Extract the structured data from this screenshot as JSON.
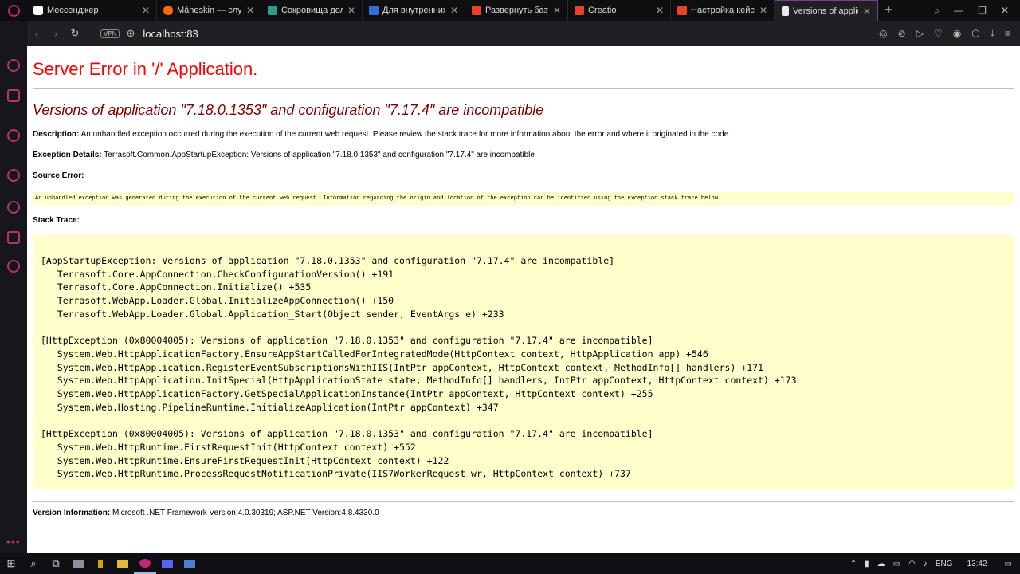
{
  "tabs": [
    {
      "label": "Мессенджер",
      "favicon_color": "#ffffff"
    },
    {
      "label": "Måneskin — слуша",
      "favicon_color": "#ff6a00"
    },
    {
      "label": "Сокровища долин",
      "favicon_color": "#2a9d8f"
    },
    {
      "label": "Для внутренних за",
      "favicon_color": "#2f6fd6"
    },
    {
      "label": "Развернуть базу д",
      "favicon_color": "#e8412c"
    },
    {
      "label": "Creatio",
      "favicon_color": "#e8412c"
    },
    {
      "label": "Настройка кейсов",
      "favicon_color": "#e8412c"
    },
    {
      "label": "Versions of applica",
      "favicon_color": "#eaeaea"
    }
  ],
  "address": {
    "url": "localhost:83",
    "vpn": "VPN"
  },
  "page": {
    "title": "Server Error in '/' Application.",
    "message": "Versions of application \"7.18.0.1353\" and configuration \"7.17.4\" are incompatible",
    "description_label": "Description:",
    "description_text": " An unhandled exception occurred during the execution of the current web request. Please review the stack trace for more information about the error and where it originated in the code.",
    "exception_label": "Exception Details:",
    "exception_text": " Terrasoft.Common.AppStartupException: Versions of application \"7.18.0.1353\" and configuration \"7.17.4\" are incompatible",
    "source_label": "Source Error:",
    "source_text": "An unhandled exception was generated during the execution of the current web request. Information regarding the origin and location of the exception can be identified using the exception stack trace below.",
    "stack_label": "Stack Trace:",
    "stack_text": "[AppStartupException: Versions of application \"7.18.0.1353\" and configuration \"7.17.4\" are incompatible]\n   Terrasoft.Core.AppConnection.CheckConfigurationVersion() +191\n   Terrasoft.Core.AppConnection.Initialize() +535\n   Terrasoft.WebApp.Loader.Global.InitializeAppConnection() +150\n   Terrasoft.WebApp.Loader.Global.Application_Start(Object sender, EventArgs e) +233\n\n[HttpException (0x80004005): Versions of application \"7.18.0.1353\" and configuration \"7.17.4\" are incompatible]\n   System.Web.HttpApplicationFactory.EnsureAppStartCalledForIntegratedMode(HttpContext context, HttpApplication app) +546\n   System.Web.HttpApplication.RegisterEventSubscriptionsWithIIS(IntPtr appContext, HttpContext context, MethodInfo[] handlers) +171\n   System.Web.HttpApplication.InitSpecial(HttpApplicationState state, MethodInfo[] handlers, IntPtr appContext, HttpContext context) +173\n   System.Web.HttpApplicationFactory.GetSpecialApplicationInstance(IntPtr appContext, HttpContext context) +255\n   System.Web.Hosting.PipelineRuntime.InitializeApplication(IntPtr appContext) +347\n\n[HttpException (0x80004005): Versions of application \"7.18.0.1353\" and configuration \"7.17.4\" are incompatible]\n   System.Web.HttpRuntime.FirstRequestInit(HttpContext context) +552\n   System.Web.HttpRuntime.EnsureFirstRequestInit(HttpContext context) +122\n   System.Web.HttpRuntime.ProcessRequestNotificationPrivate(IIS7WorkerRequest wr, HttpContext context) +737",
    "version_label": "Version Information:",
    "version_text": " Microsoft .NET Framework Version:4.0.30319; ASP.NET Version:4.8.4330.0"
  },
  "taskbar": {
    "lang": "ENG",
    "time": "13:42"
  },
  "colors": {
    "error_title": "#ff0000",
    "message": "#800000",
    "code_bg": "#ffffcc",
    "opera_accent": "#c4286c"
  }
}
